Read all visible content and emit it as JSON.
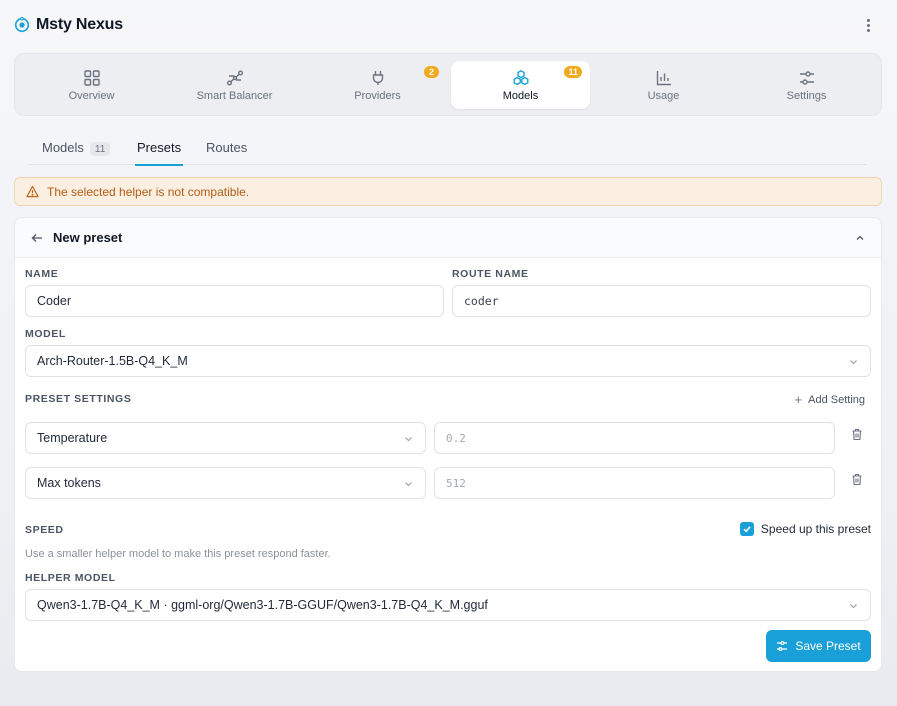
{
  "app": {
    "title": "Msty Nexus"
  },
  "main_nav": [
    {
      "label": "Overview",
      "icon": "grid-icon",
      "badge": null,
      "active": false
    },
    {
      "label": "Smart Balancer",
      "icon": "route-icon",
      "badge": null,
      "active": false
    },
    {
      "label": "Providers",
      "icon": "plug-icon",
      "badge": "2",
      "active": false
    },
    {
      "label": "Models",
      "icon": "cubes-icon",
      "badge": "11",
      "active": true
    },
    {
      "label": "Usage",
      "icon": "bar-chart-icon",
      "badge": null,
      "active": false
    },
    {
      "label": "Settings",
      "icon": "sliders-icon",
      "badge": null,
      "active": false
    }
  ],
  "subtabs": [
    {
      "label": "Models",
      "count": "11",
      "active": false
    },
    {
      "label": "Presets",
      "count": null,
      "active": true
    },
    {
      "label": "Routes",
      "count": null,
      "active": false
    }
  ],
  "alert": {
    "text": "The selected helper is not compatible.",
    "color": "#b45c12"
  },
  "form": {
    "title": "New preset",
    "name_label": "NAME",
    "name_value": "Coder",
    "route_name_label": "ROUTE NAME",
    "route_name_value": "coder",
    "model_label": "MODEL",
    "model_value": "Arch-Router-1.5B-Q4_K_M",
    "preset_settings_label": "PRESET SETTINGS",
    "add_setting_label": "Add Setting",
    "settings": [
      {
        "key": "Temperature",
        "placeholder": "0.2"
      },
      {
        "key": "Max tokens",
        "placeholder": "512"
      }
    ],
    "speed_label": "SPEED",
    "speed_checkbox_label": "Speed up this preset",
    "speed_checked": true,
    "speed_hint": "Use a smaller helper model to make this preset respond faster.",
    "helper_model_label": "HELPER MODEL",
    "helper_model_value": "Qwen3-1.7B-Q4_K_M · ggml-org/Qwen3-1.7B-GGUF/Qwen3-1.7B-Q4_K_M.gguf",
    "save_label": "Save Preset"
  },
  "colors": {
    "accent": "#1aa0d8",
    "badge": "#f2a91b",
    "alert_bg": "#fbefe2"
  }
}
